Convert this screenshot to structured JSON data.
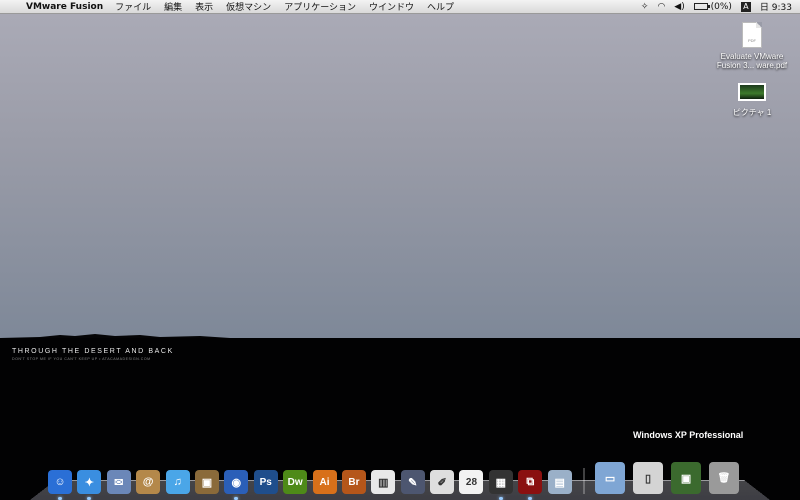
{
  "menubar": {
    "apple_glyph": "",
    "app_name": "VMware Fusion",
    "menus": [
      "ファイル",
      "編集",
      "表示",
      "仮想マシン",
      "アプリケーション",
      "ウインドウ",
      "ヘルプ"
    ],
    "battery_text": "(0%)",
    "input_glyph": "A",
    "clock": "日 9:33"
  },
  "desktop": {
    "icons": [
      {
        "label": "Evaluate VMware Fusion 3... ware.pdf",
        "kind": "pdf-file-icon",
        "badge": "PDF"
      },
      {
        "label": "ピクチャ 1",
        "kind": "picture-file-icon"
      }
    ],
    "wallpaper_title": "THROUGH THE DESERT AND BACK",
    "wallpaper_subtitle": "DON'T STOP ME IF YOU CAN'T KEEP UP • ATACAMADESIGN.COM"
  },
  "vm_label": "Windows XP Professional",
  "dock": {
    "apps": [
      {
        "name": "finder-icon",
        "glyph": "☺",
        "color": "#2a6fd6"
      },
      {
        "name": "safari-icon",
        "glyph": "✦",
        "color": "#3a8ee0"
      },
      {
        "name": "mail-icon",
        "glyph": "✉",
        "color": "#6b87b8"
      },
      {
        "name": "address-book-icon",
        "glyph": "@",
        "color": "#b4884a"
      },
      {
        "name": "itunes-icon",
        "glyph": "♫",
        "color": "#4aa6e8"
      },
      {
        "name": "iphoto-icon",
        "glyph": "▣",
        "color": "#8a6a3a"
      },
      {
        "name": "camera-icon",
        "glyph": "◉",
        "color": "#2b5fb8"
      },
      {
        "name": "photoshop-icon",
        "glyph": "Ps",
        "color": "#1f4e8c"
      },
      {
        "name": "dreamweaver-icon",
        "glyph": "Dw",
        "color": "#4e8a18"
      },
      {
        "name": "illustrator-icon",
        "glyph": "Ai",
        "color": "#d8701a"
      },
      {
        "name": "bridge-icon",
        "glyph": "Br",
        "color": "#b5561a"
      },
      {
        "name": "chart-app-icon",
        "glyph": "▥",
        "color": "#e8e8e8"
      },
      {
        "name": "pen-tool-icon",
        "glyph": "✎",
        "color": "#4d5670"
      },
      {
        "name": "textedit-icon",
        "glyph": "✐",
        "color": "#dedede"
      },
      {
        "name": "calendar-icon",
        "glyph": "28",
        "color": "#f2f2f2"
      },
      {
        "name": "vm-cube-icon",
        "glyph": "▦",
        "color": "#333333"
      },
      {
        "name": "vmware-icon",
        "glyph": "⧉",
        "color": "#8a1010"
      },
      {
        "name": "preview-icon",
        "glyph": "▤",
        "color": "#9ab0c8"
      }
    ],
    "right_items": [
      {
        "name": "folder-icon",
        "glyph": "▭",
        "color": "#7fa6d4"
      },
      {
        "name": "documents-stack-icon",
        "glyph": "▯",
        "color": "#d4d4d4"
      },
      {
        "name": "windows-vm-thumbnail-icon",
        "glyph": "▣",
        "color": "#3b6a2e"
      },
      {
        "name": "trash-icon",
        "glyph": "🗑",
        "color": "#9a9a9a"
      }
    ]
  }
}
